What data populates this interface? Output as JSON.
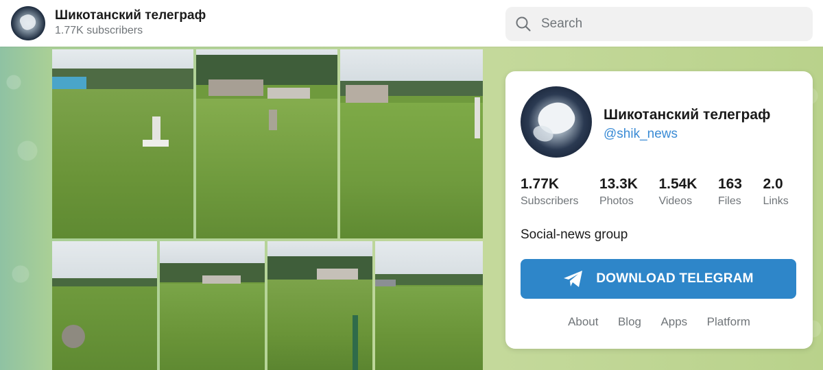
{
  "header": {
    "title": "Шикотанский телеграф",
    "subscribers": "1.77K subscribers"
  },
  "search": {
    "placeholder": "Search"
  },
  "card": {
    "name": "Шикотанский телеграф",
    "handle": "@shik_news",
    "stats": [
      {
        "value": "1.77K",
        "label": "Subscribers"
      },
      {
        "value": "13.3K",
        "label": "Photos"
      },
      {
        "value": "1.54K",
        "label": "Videos"
      },
      {
        "value": "163",
        "label": "Files"
      },
      {
        "value": "2.0",
        "label": "Links"
      }
    ],
    "description": "Social-news group",
    "download_label": "DOWNLOAD TELEGRAM",
    "footer_links": [
      "About",
      "Blog",
      "Apps",
      "Platform"
    ]
  },
  "icons": {
    "search": "search-icon",
    "download": "telegram-plane-icon"
  },
  "colors": {
    "accent": "#2e86c9",
    "handle": "#3a8bd5"
  }
}
